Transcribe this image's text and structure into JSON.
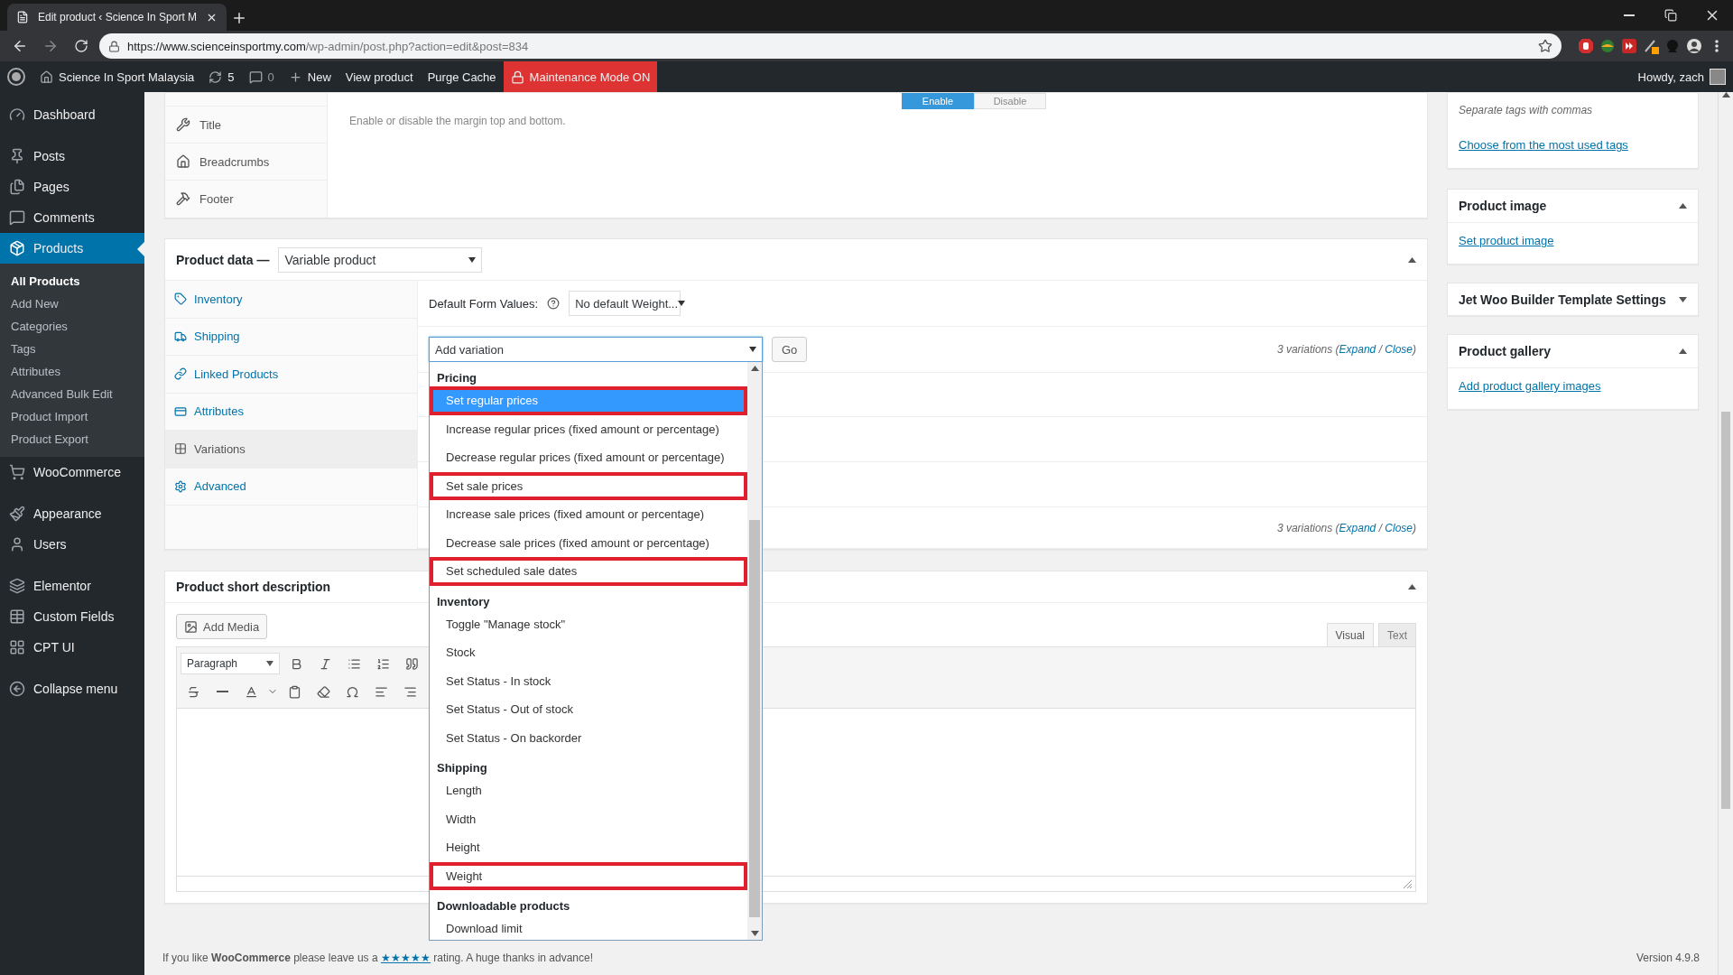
{
  "browser": {
    "tab_title": "Edit product ‹ Science In Sport M",
    "url_host": "https://www.scienceinsportmy.com",
    "url_path": "/wp-admin/post.php?action=edit&post=834"
  },
  "admin_bar": {
    "site_name": "Science In Sport Malaysia",
    "updates": "5",
    "comments": "0",
    "new": "New",
    "view": "View product",
    "purge": "Purge Cache",
    "maintenance": "Maintenance Mode ON",
    "howdy": "Howdy, zach"
  },
  "sidebar": {
    "menu": [
      {
        "label": "Dashboard",
        "selected": false,
        "gap_before": false
      },
      {
        "label": "Posts",
        "selected": false,
        "gap_before": true
      },
      {
        "label": "Pages",
        "selected": false,
        "gap_before": false
      },
      {
        "label": "Comments",
        "selected": false,
        "gap_before": false
      },
      {
        "label": "Products",
        "selected": true,
        "gap_before": false,
        "children": [
          {
            "label": "All Products",
            "selected": true
          },
          {
            "label": "Add New",
            "selected": false
          },
          {
            "label": "Categories",
            "selected": false
          },
          {
            "label": "Tags",
            "selected": false
          },
          {
            "label": "Attributes",
            "selected": false
          },
          {
            "label": "Advanced Bulk Edit",
            "selected": false
          },
          {
            "label": "Product Import",
            "selected": false
          },
          {
            "label": "Product Export",
            "selected": false
          }
        ]
      },
      {
        "label": "WooCommerce",
        "selected": false,
        "gap_before": false
      },
      {
        "label": "Appearance",
        "selected": false,
        "gap_before": true
      },
      {
        "label": "Users",
        "selected": false,
        "gap_before": false
      },
      {
        "label": "Elementor",
        "selected": false,
        "gap_before": true
      },
      {
        "label": "Custom Fields",
        "selected": false,
        "gap_before": false
      },
      {
        "label": "CPT UI",
        "selected": false,
        "gap_before": false
      },
      {
        "label": "Collapse menu",
        "selected": false,
        "gap_before": true
      }
    ]
  },
  "settings_card": {
    "tabs": [
      {
        "label": "Title",
        "selected": false
      },
      {
        "label": "Breadcrumbs",
        "selected": false
      },
      {
        "label": "Footer",
        "selected": false
      }
    ],
    "toggle": [
      {
        "label": "Enable",
        "selected": true
      },
      {
        "label": "Disable",
        "selected": false
      }
    ],
    "description": "Enable or disable the margin top and bottom."
  },
  "product_data": {
    "title": "Product data —",
    "type": "Variable product",
    "expanded": true,
    "tabs": [
      {
        "label": "Inventory",
        "selected": false
      },
      {
        "label": "Shipping",
        "selected": false
      },
      {
        "label": "Linked Products",
        "selected": false
      },
      {
        "label": "Attributes",
        "selected": false
      },
      {
        "label": "Variations",
        "selected": true
      },
      {
        "label": "Advanced",
        "selected": false
      }
    ],
    "default_form_label": "Default Form Values:",
    "default_form_value": "No default Weight...",
    "action_select": "Add variation",
    "go": "Go",
    "variations_notes": [
      {
        "before": "3 variations (",
        "expand": "Expand",
        "sep": " / ",
        "close": "Close",
        "after": ")"
      },
      {
        "before": "3 variations (",
        "expand": "Expand",
        "sep": " / ",
        "close": "Close",
        "after": ")"
      }
    ],
    "bulk_menu": [
      {
        "label": "Pricing",
        "options": [
          {
            "label": "Set regular prices",
            "selected": true,
            "highlighted": true
          },
          {
            "label": "Increase regular prices (fixed amount or percentage)",
            "selected": false,
            "highlighted": false
          },
          {
            "label": "Decrease regular prices (fixed amount or percentage)",
            "selected": false,
            "highlighted": false
          },
          {
            "label": "Set sale prices",
            "selected": false,
            "highlighted": true
          },
          {
            "label": "Increase sale prices (fixed amount or percentage)",
            "selected": false,
            "highlighted": false
          },
          {
            "label": "Decrease sale prices (fixed amount or percentage)",
            "selected": false,
            "highlighted": false
          },
          {
            "label": "Set scheduled sale dates",
            "selected": false,
            "highlighted": true
          }
        ]
      },
      {
        "label": "Inventory",
        "options": [
          {
            "label": "Toggle \"Manage stock\"",
            "selected": false,
            "highlighted": false
          },
          {
            "label": "Stock",
            "selected": false,
            "highlighted": false
          },
          {
            "label": "Set Status - In stock",
            "selected": false,
            "highlighted": false
          },
          {
            "label": "Set Status - Out of stock",
            "selected": false,
            "highlighted": false
          },
          {
            "label": "Set Status - On backorder",
            "selected": false,
            "highlighted": false
          }
        ]
      },
      {
        "label": "Shipping",
        "options": [
          {
            "label": "Length",
            "selected": false,
            "highlighted": false
          },
          {
            "label": "Width",
            "selected": false,
            "highlighted": false
          },
          {
            "label": "Height",
            "selected": false,
            "highlighted": false
          },
          {
            "label": "Weight",
            "selected": false,
            "highlighted": true
          }
        ]
      },
      {
        "label": "Downloadable products",
        "options": [
          {
            "label": "Download limit",
            "selected": false,
            "highlighted": false
          }
        ]
      }
    ]
  },
  "short_description": {
    "title": "Product short description",
    "expanded": true,
    "add_media": "Add Media",
    "format": "Paragraph",
    "tabs": [
      {
        "label": "Visual",
        "selected": true
      },
      {
        "label": "Text",
        "selected": false
      }
    ]
  },
  "side_boxes": {
    "tags_hint": "Separate tags with commas",
    "tags_link": "Choose from the most used tags",
    "boxes": [
      {
        "title": "Product image",
        "expanded": true,
        "link": "Set product image"
      },
      {
        "title": "Jet Woo Builder Template Settings",
        "expanded": false
      },
      {
        "title": "Product gallery",
        "expanded": true,
        "link": "Add product gallery images"
      }
    ]
  },
  "footer": {
    "text": "If you like **WooCommerce** please leave us a ",
    "stars": "★★★★★",
    "after": " rating. A huge thanks in advance!",
    "version": "Version 4.9.8"
  }
}
